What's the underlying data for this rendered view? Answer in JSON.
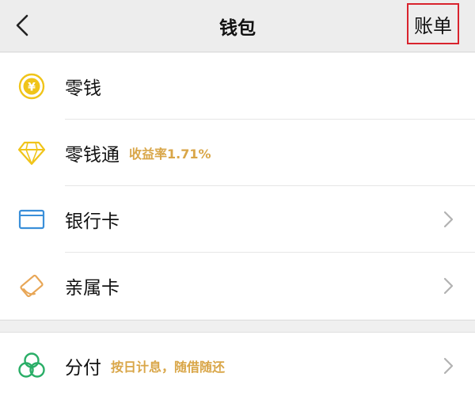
{
  "header": {
    "back_icon": "chevron-left-icon",
    "title": "钱包",
    "bill_label": "账单"
  },
  "wallet_items": [
    {
      "label": "零钱",
      "tag": "",
      "icon": "yuan-coin-icon",
      "has_chevron": false
    },
    {
      "label": "零钱通",
      "tag": "收益率1.71%",
      "icon": "diamond-icon",
      "has_chevron": false
    },
    {
      "label": "银行卡",
      "tag": "",
      "icon": "bank-card-icon",
      "has_chevron": true
    },
    {
      "label": "亲属卡",
      "tag": "",
      "icon": "family-card-icon",
      "has_chevron": true
    }
  ],
  "credit_items": [
    {
      "label": "分付",
      "tag": "按日计息，随借随还",
      "icon": "fenfu-icon",
      "has_chevron": true
    }
  ],
  "colors": {
    "accent_gold": "#d9a648",
    "icon_yellow": "#f0c419",
    "icon_blue": "#3a8fd9",
    "icon_orange": "#e8a656",
    "icon_green": "#2aae67",
    "highlight_red": "#d9232d"
  }
}
